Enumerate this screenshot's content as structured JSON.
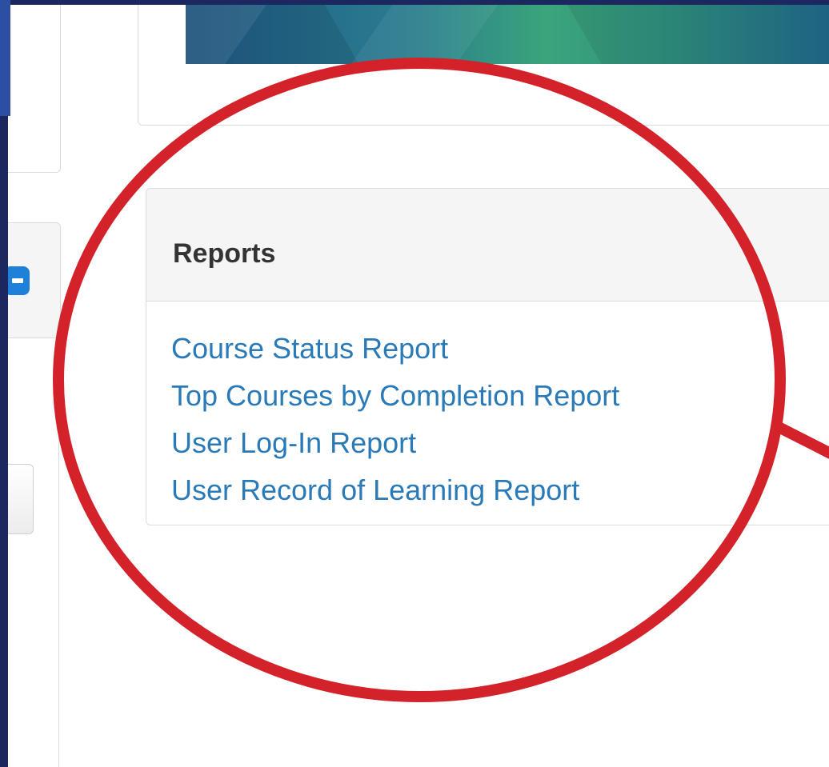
{
  "reports": {
    "title": "Reports",
    "links": [
      "Course Status Report",
      "Top Courses by Completion Report",
      "User Log-In Report",
      "User Record of Learning Report"
    ]
  },
  "colors": {
    "frame": "#1c2760",
    "link": "#2a7ab8",
    "annotation": "#d3222a",
    "panel_header": "#f5f5f5"
  },
  "icons": {
    "collapse": "minus-icon"
  }
}
